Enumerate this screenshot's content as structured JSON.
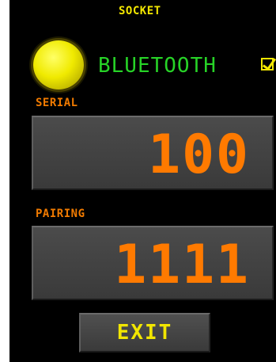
{
  "screen": {
    "title": "SOCKET"
  },
  "bluetooth": {
    "label": "BLUETOOTH",
    "status_indicator": "led-on",
    "indicator_color": "#f0ea00",
    "checkbox_checked": true
  },
  "serial": {
    "label": "SERIAL",
    "value": "100"
  },
  "pairing": {
    "label": "PAIRING",
    "value": "1111"
  },
  "exit_button": {
    "label": "EXIT"
  },
  "colors": {
    "background": "#000000",
    "title": "#f2e600",
    "bluetooth_text": "#27d327",
    "field_label": "#f07a00",
    "value_text": "#ff7a00",
    "panel": "#444444"
  }
}
